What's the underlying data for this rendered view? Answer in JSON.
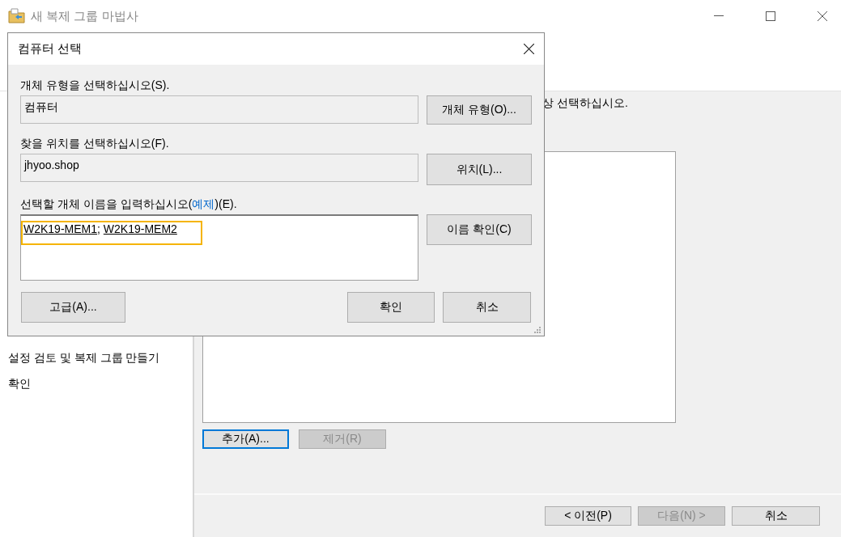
{
  "window": {
    "title": "새 복제 그룹 마법사"
  },
  "steps": [
    {
      "label": "설정 검토 및 복제 그룹 만들기"
    },
    {
      "label": "확인"
    }
  ],
  "instruction": "상 선택하십시오.",
  "list_buttons": [
    {
      "label": "추가(A)...",
      "disabled": false,
      "focused": true
    },
    {
      "label": "제거(R)",
      "disabled": true,
      "focused": false
    }
  ],
  "footer_buttons": [
    {
      "label": "< 이전(P)",
      "disabled": false
    },
    {
      "label": "다음(N) >",
      "disabled": true
    },
    {
      "label": "취소",
      "disabled": false
    }
  ],
  "dialog": {
    "title": "컴퓨터 선택",
    "object_type": {
      "label": "개체 유형을 선택하십시오(S).",
      "value": "컴퓨터",
      "button": "개체 유형(O)..."
    },
    "location": {
      "label": "찾을 위치를 선택하십시오(F).",
      "value": "jhyoo.shop",
      "button": "위치(L)..."
    },
    "names": {
      "label_before": "선택할 개체 이름을 입력하십시오(",
      "link": "예제",
      "label_after": ")(E).",
      "entries": [
        "W2K19-MEM1",
        "W2K19-MEM2"
      ],
      "separator": "; ",
      "button": "이름 확인(C)",
      "highlighted": true
    },
    "buttons": [
      {
        "label": "고급(A)...",
        "kind": "advanced"
      },
      {
        "label": "확인",
        "kind": "ok"
      },
      {
        "label": "취소",
        "kind": "cancel"
      }
    ]
  }
}
